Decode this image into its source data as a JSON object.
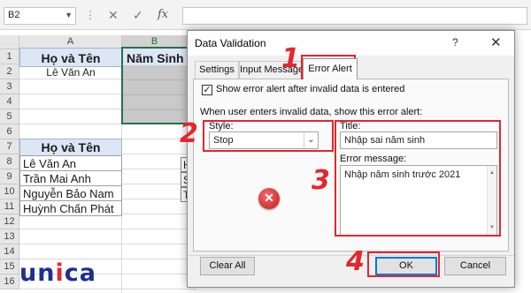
{
  "formula_bar": {
    "name_box": "B2",
    "dots": "⋮",
    "cancel_glyph": "✕",
    "enter_glyph": "✓",
    "fx_label": "fx",
    "formula": ""
  },
  "sheet": {
    "columns": [
      "A",
      "B"
    ],
    "rows": [
      "1",
      "2",
      "3",
      "4",
      "5",
      "6",
      "7",
      "8",
      "9",
      "10",
      "11",
      "12",
      "13",
      "14",
      "15",
      "16"
    ],
    "header1": {
      "col_a": "Họ và Tên",
      "col_b": "Năm Sinh"
    },
    "row2_name": "Lê Văn An",
    "header2": "Họ và Tên",
    "names": [
      "Lê Văn An",
      "Trần Mai Anh",
      "Nguyễn Bảo Nam",
      "Huỳnh Chấn Phát"
    ],
    "peek_cells": [
      "H",
      "S",
      "T"
    ]
  },
  "logo": {
    "u": "u",
    "n": "n",
    "i": "i",
    "ca": "ca"
  },
  "dialog": {
    "title": "Data Validation",
    "help": "?",
    "close": "✕",
    "tabs": [
      "Settings",
      "Input Message",
      "Error Alert"
    ],
    "active_tab": "Error Alert",
    "show_alert_checked": true,
    "checkbox_mark": "✓",
    "show_alert_label": "Show error alert after invalid data is entered",
    "instruction": "When user enters invalid data, show this error alert:",
    "style_label": "Style:",
    "style_value": "Stop",
    "style_caret": "⌄",
    "title_label": "Title:",
    "title_value": "Nhập sai năm sinh",
    "message_label": "Error message:",
    "message_value": "Nhập năm sinh trước 2021",
    "stop_glyph": "✕",
    "clear_all_label": "Clear All",
    "ok_label": "OK",
    "cancel_label": "Cancel"
  },
  "annotations": {
    "numbers": [
      "1",
      "2",
      "3",
      "4"
    ],
    "color": "#e4262d"
  },
  "colors": {
    "header_fill": "#dce6f5",
    "selection_green": "#217346",
    "logo_blue": "#1d2f8f",
    "logo_red": "#e0282f"
  }
}
